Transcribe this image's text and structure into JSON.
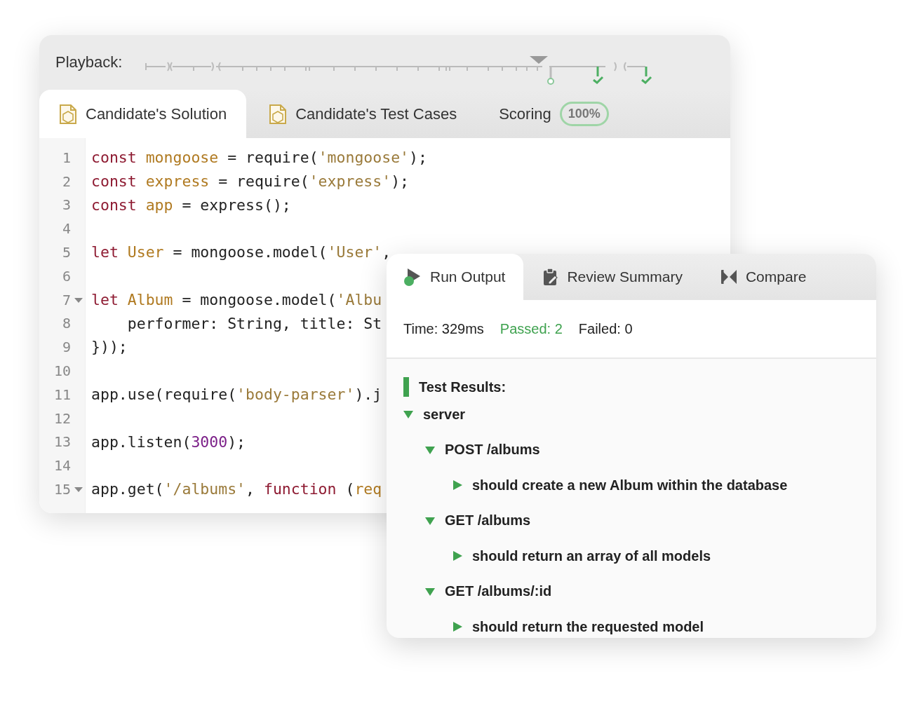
{
  "editor": {
    "playback_label": "Playback:",
    "tabs": [
      {
        "label": "Candidate's Solution",
        "kind": "file",
        "selected": true
      },
      {
        "label": "Candidate's Test Cases",
        "kind": "file",
        "selected": false
      },
      {
        "label": "Scoring",
        "kind": "score",
        "badge": "100%",
        "selected": false
      }
    ],
    "lines": [
      {
        "number": "1",
        "fold": false,
        "tokens": [
          {
            "kind": "keyword",
            "text": "const "
          },
          {
            "kind": "variable",
            "text": "mongoose"
          },
          {
            "kind": "plain",
            "text": " = require("
          },
          {
            "kind": "string",
            "text": "'mongoose'"
          },
          {
            "kind": "plain",
            "text": ");"
          }
        ]
      },
      {
        "number": "2",
        "fold": false,
        "tokens": [
          {
            "kind": "keyword",
            "text": "const "
          },
          {
            "kind": "variable",
            "text": "express"
          },
          {
            "kind": "plain",
            "text": " = require("
          },
          {
            "kind": "string",
            "text": "'express'"
          },
          {
            "kind": "plain",
            "text": ");"
          }
        ]
      },
      {
        "number": "3",
        "fold": false,
        "tokens": [
          {
            "kind": "keyword",
            "text": "const "
          },
          {
            "kind": "variable",
            "text": "app"
          },
          {
            "kind": "plain",
            "text": " = express();"
          }
        ]
      },
      {
        "number": "4",
        "fold": false
      },
      {
        "number": "5",
        "fold": false,
        "tokens": [
          {
            "kind": "keyword",
            "text": "let "
          },
          {
            "kind": "variable",
            "text": "User"
          },
          {
            "kind": "plain",
            "text": " = mongoose.model("
          },
          {
            "kind": "string",
            "text": "'User'"
          },
          {
            "kind": "plain",
            "text": ","
          }
        ]
      },
      {
        "number": "6",
        "fold": false
      },
      {
        "number": "7",
        "fold": true,
        "tokens": [
          {
            "kind": "keyword",
            "text": "let "
          },
          {
            "kind": "variable",
            "text": "Album"
          },
          {
            "kind": "plain",
            "text": " = mongoose.model("
          },
          {
            "kind": "string",
            "text": "'Albu"
          }
        ]
      },
      {
        "number": "8",
        "fold": false,
        "tokens": [
          {
            "kind": "plain",
            "text": "    performer: String, title: St"
          }
        ]
      },
      {
        "number": "9",
        "fold": false,
        "tokens": [
          {
            "kind": "plain",
            "text": "}));"
          }
        ]
      },
      {
        "number": "10",
        "fold": false
      },
      {
        "number": "11",
        "fold": false,
        "tokens": [
          {
            "kind": "plain",
            "text": "app.use(require("
          },
          {
            "kind": "string",
            "text": "'body-parser'"
          },
          {
            "kind": "plain",
            "text": ").j"
          }
        ]
      },
      {
        "number": "12",
        "fold": false
      },
      {
        "number": "13",
        "fold": false,
        "tokens": [
          {
            "kind": "plain",
            "text": "app.listen("
          },
          {
            "kind": "number",
            "text": "3000"
          },
          {
            "kind": "plain",
            "text": ");"
          }
        ]
      },
      {
        "number": "14",
        "fold": false
      },
      {
        "number": "15",
        "fold": true,
        "tokens": [
          {
            "kind": "plain",
            "text": "app.get("
          },
          {
            "kind": "string",
            "text": "'/albums'"
          },
          {
            "kind": "plain",
            "text": ", "
          },
          {
            "kind": "keyword",
            "text": "function"
          },
          {
            "kind": "plain",
            "text": " ("
          },
          {
            "kind": "variable",
            "text": "req"
          }
        ]
      }
    ]
  },
  "output": {
    "tabs": [
      {
        "label": "Run Output",
        "selected": true
      },
      {
        "label": "Review Summary",
        "selected": false
      },
      {
        "label": "Compare",
        "selected": false
      }
    ],
    "stats": [
      {
        "text": "Time: 329ms",
        "kind": "neutral"
      },
      {
        "text": "Passed: 2",
        "kind": "passed"
      },
      {
        "text": "Failed: 0",
        "kind": "neutral"
      }
    ],
    "results_title": "Test Results:",
    "tree": [
      {
        "label": "server",
        "expanded": true,
        "children": [
          {
            "label": "POST /albums",
            "expanded": true,
            "children": [
              {
                "label": "should create a new Album within the database",
                "kind": "test"
              }
            ]
          },
          {
            "label": "GET /albums",
            "expanded": true,
            "children": [
              {
                "label": "should return an array of all models",
                "kind": "test"
              }
            ]
          },
          {
            "label": "GET /albums/:id",
            "expanded": true,
            "children": [
              {
                "label": "should return the requested model",
                "kind": "test"
              }
            ]
          }
        ]
      }
    ]
  }
}
